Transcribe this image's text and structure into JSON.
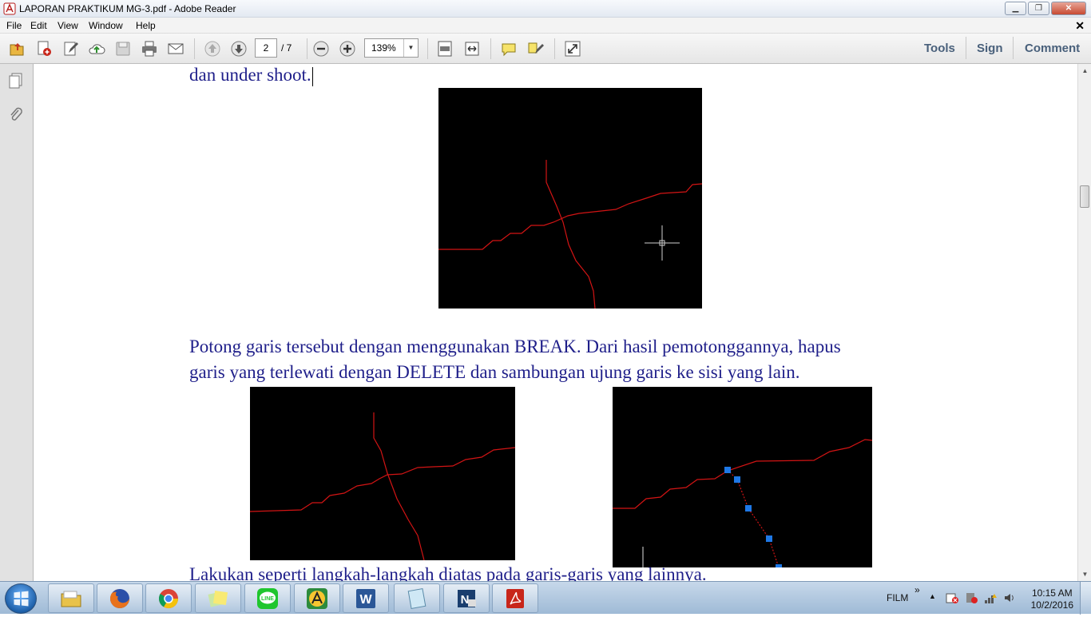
{
  "window": {
    "title": "LAPORAN PRAKTIKUM MG-3.pdf - Adobe Reader",
    "controls": {
      "minimize": "▁",
      "restore": "❐",
      "close": "✕"
    }
  },
  "menu": {
    "items": [
      "File",
      "Edit",
      "View",
      "Window",
      "Help"
    ],
    "doc_close": "✕"
  },
  "toolbar": {
    "page_current": "2",
    "page_total": "/ 7",
    "zoom": "139%",
    "right_links": [
      "Tools",
      "Sign",
      "Comment"
    ]
  },
  "document": {
    "line1": "dan under shoot.",
    "para1_line1": "Potong garis tersebut dengan menggunakan BREAK. Dari hasil pemotonggannya, hapus",
    "para1_line2": "garis yang terlewati dengan DELETE dan sambungan ujung garis ke sisi yang lain.",
    "para2_line1": "Lakukan seperti langkah-langkah diatas pada garis-garis yang lainnya."
  },
  "taskbar": {
    "apps": [
      "file-explorer",
      "firefox",
      "chrome",
      "sticky-notes",
      "line",
      "archicad",
      "word",
      "notepad",
      "mapinfo",
      "adobe-reader"
    ],
    "tray_label": "FILM",
    "tray_expand": "»",
    "time": "10:15 AM",
    "date": "10/2/2016"
  },
  "colors": {
    "doc_text": "#1f1f8a",
    "cad_line": "#d21414",
    "cad_grip": "#1e78e6",
    "toolbar_link": "#49607b"
  }
}
